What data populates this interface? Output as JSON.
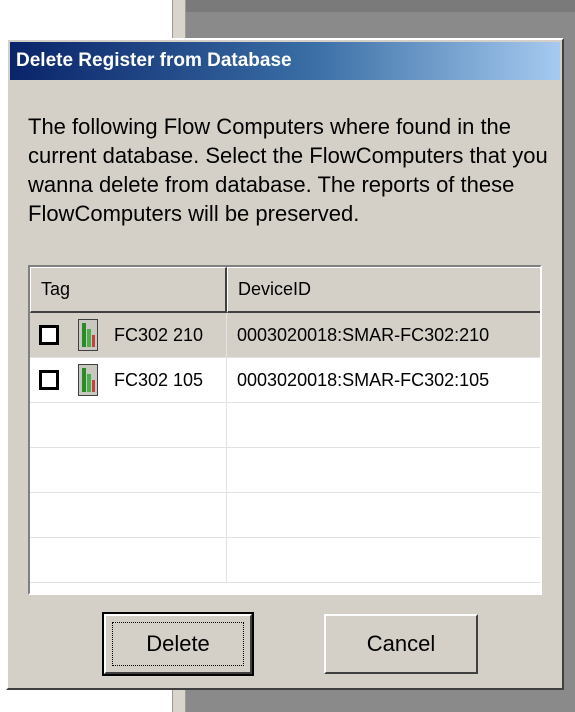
{
  "dialog": {
    "title": "Delete Register from Database",
    "message": "The following Flow Computers where found in the current database. Select the FlowComputers that you wanna delete from database. The reports of these FlowComputers will be preserved."
  },
  "list": {
    "columns": [
      "Tag",
      "DeviceID"
    ],
    "rows": [
      {
        "tag": "FC302 210",
        "device_id": "0003020018:SMAR-FC302:210",
        "checked": false,
        "selected": true
      },
      {
        "tag": "FC302 105",
        "device_id": "0003020018:SMAR-FC302:105",
        "checked": false,
        "selected": false
      }
    ],
    "icon": "flow-computer-icon"
  },
  "buttons": {
    "delete_label": "Delete",
    "cancel_label": "Cancel"
  },
  "colors": {
    "titlebar_start": "#0a246a",
    "titlebar_end": "#a6caf0",
    "face": "#d4d0c8"
  }
}
